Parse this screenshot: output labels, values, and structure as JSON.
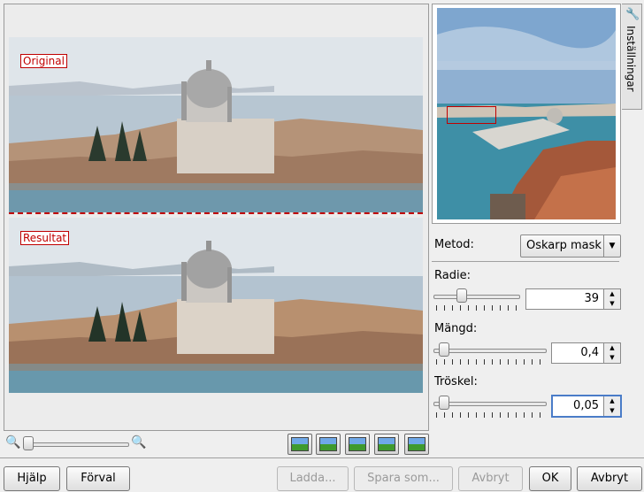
{
  "preview": {
    "original_label": "Original",
    "result_label": "Resultat"
  },
  "settings_tab": {
    "label": "Inställningar",
    "icon": "wrench-icon"
  },
  "method": {
    "label": "Metod:",
    "value": "Oskarp mask"
  },
  "radius": {
    "label": "Radie:",
    "value": "39",
    "slider_fraction": 0.3
  },
  "amount": {
    "label": "Mängd:",
    "value": "0,4",
    "slider_fraction": 0.05
  },
  "threshold": {
    "label": "Tröskel:",
    "value": "0,05",
    "slider_fraction": 0.05
  },
  "zoom": {
    "out_icon": "zoom-out-icon",
    "in_icon": "zoom-in-icon",
    "slider_fraction": 0.0
  },
  "preview_modes": [
    "mode-1-icon",
    "mode-2-icon",
    "mode-3-icon",
    "mode-4-icon",
    "mode-5-icon"
  ],
  "buttons": {
    "help": "Hjälp",
    "defaults": "Förval",
    "load": "Ladda...",
    "save_as": "Spara som...",
    "abort": "Avbryt",
    "ok": "OK",
    "cancel": "Avbryt"
  },
  "colors": {
    "marker_red": "#c00000",
    "focus_blue": "#4a7cc8"
  }
}
